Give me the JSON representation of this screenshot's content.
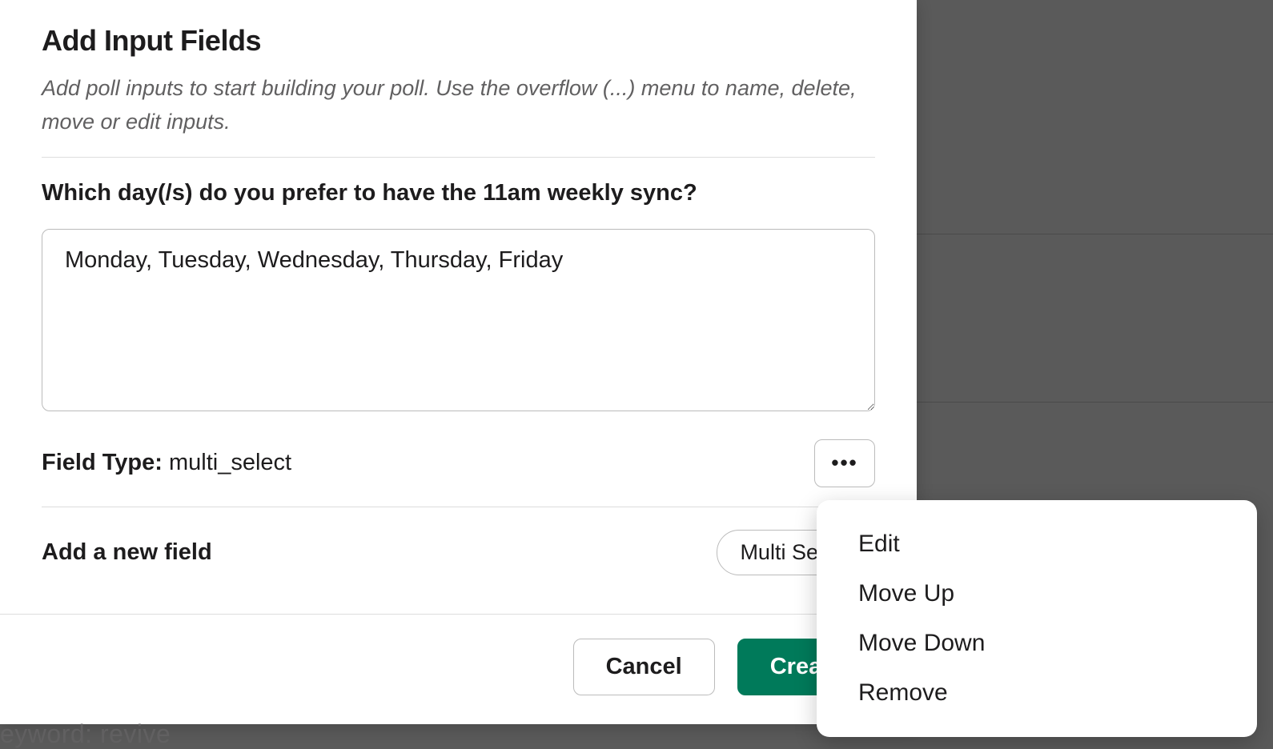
{
  "header": {
    "title": "Add Input Fields",
    "subtitle": "Add poll inputs to start building your poll. Use the overflow (...) menu to name, delete, move or edit inputs."
  },
  "question": {
    "label": "Which day(/s) do you prefer to have the 11am weekly sync?",
    "value": "Monday, Tuesday, Wednesday, Thursday, Friday"
  },
  "field_type": {
    "label": "Field Type: ",
    "value": "multi_select"
  },
  "add_field": {
    "label": "Add a new field",
    "select_value": "Multi Select"
  },
  "footer": {
    "cancel": "Cancel",
    "create": "Create"
  },
  "overflow_menu": {
    "items": [
      "Edit",
      "Move Up",
      "Move Down",
      "Remove"
    ]
  },
  "background": {
    "partial_text": "eyword: revive"
  }
}
